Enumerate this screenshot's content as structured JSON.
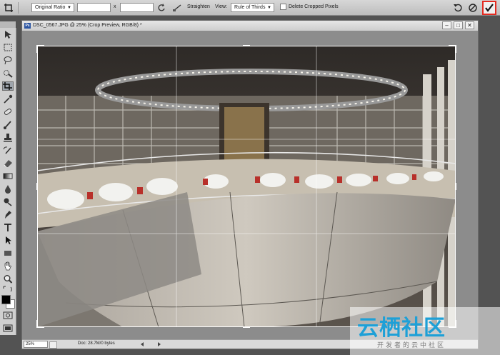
{
  "options_bar": {
    "ratio_select": "Original Ratio",
    "x_separator": "x",
    "straighten_label": "Straighten",
    "view_label": "View:",
    "view_select": "Rule of Thirds",
    "delete_cropped_label": "Delete Cropped Pixels",
    "delete_cropped_checked": false,
    "width_value": "",
    "height_value": ""
  },
  "document": {
    "title": "DSC_0567.JPG @ 25% (Crop Preview, RGB/8) *",
    "ps_icon": "Ps",
    "minimize": "–",
    "maximize": "□",
    "close": "✕"
  },
  "status": {
    "zoom": "25%",
    "doc_info": "Doc: 28.7M/0 bytes"
  },
  "watermark": {
    "logo": "云栖社区",
    "subtitle": "开发者的云中社区"
  },
  "colors": {
    "accent": "#e32c22",
    "foreground_color": "#000000",
    "background_color": "#ffffff"
  },
  "icons": [
    "crop-icon",
    "rotate-icon",
    "straighten-icon",
    "reset-icon",
    "cancel-icon",
    "commit-icon"
  ]
}
